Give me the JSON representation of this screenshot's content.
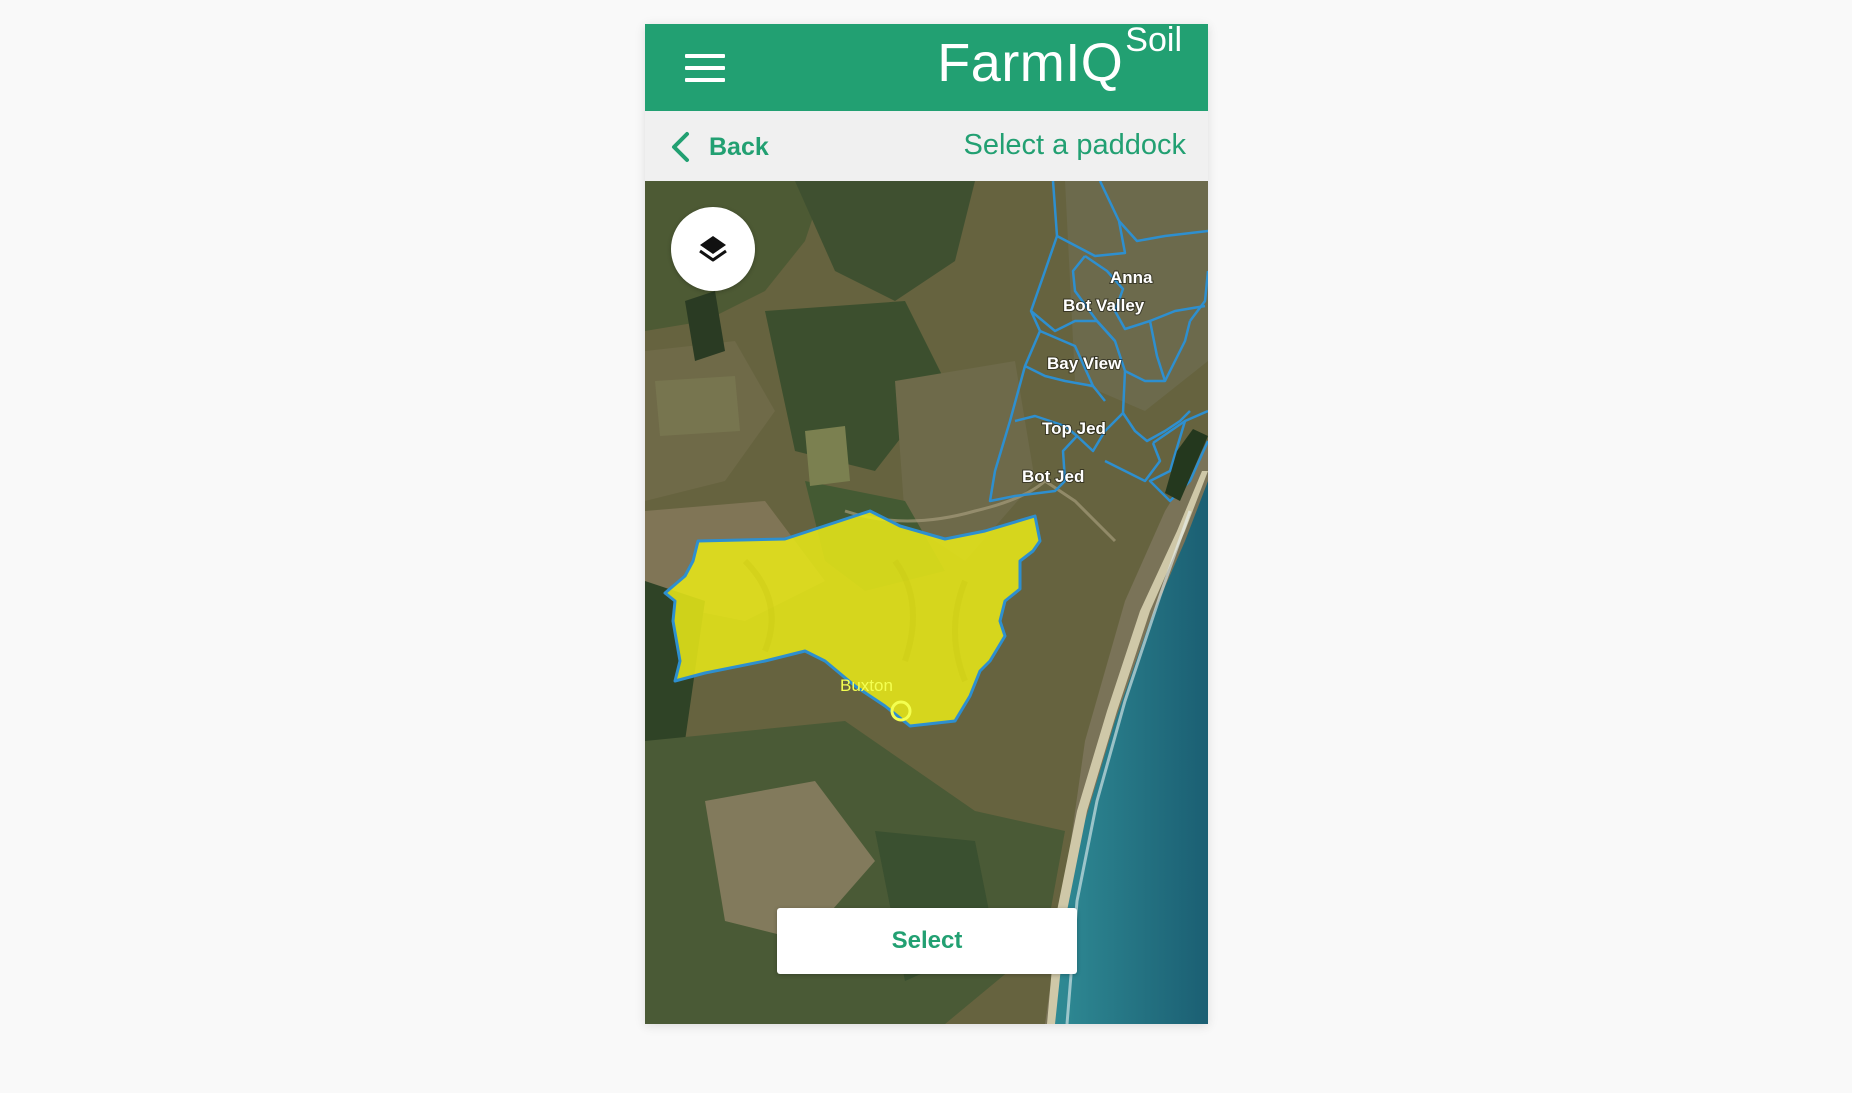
{
  "app": {
    "logo_main": "FarmIQ",
    "logo_sup": "Soil",
    "menu_icon": "hamburger-menu-icon",
    "header_color": "#22a072"
  },
  "nav": {
    "back_label": "Back",
    "back_icon": "chevron-left-icon",
    "title": "Select a paddock"
  },
  "map": {
    "layers_icon": "layers-icon",
    "paddocks": [
      {
        "name": "Anna"
      },
      {
        "name": "Bot Valley"
      },
      {
        "name": "Bay View"
      },
      {
        "name": "Top Jed"
      },
      {
        "name": "Bot Jed"
      },
      {
        "name": "Buxton",
        "selected": true
      }
    ],
    "selected_color": "#e6e619",
    "boundary_color": "#2e8fcf"
  },
  "actions": {
    "select_label": "Select"
  }
}
